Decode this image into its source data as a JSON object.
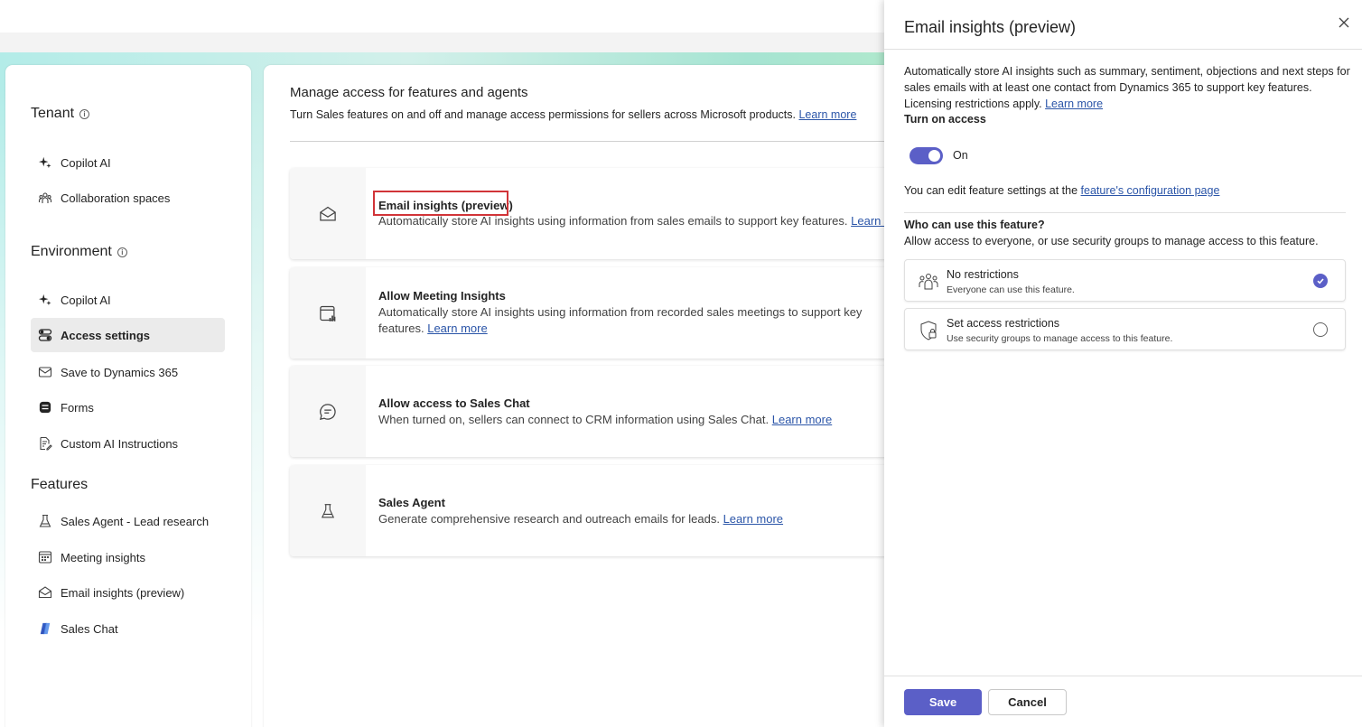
{
  "leftnav": {
    "tenant": {
      "title": "Tenant",
      "items": [
        {
          "label": "Copilot AI",
          "icon": "sparkle-icon"
        },
        {
          "label": "Collaboration spaces",
          "icon": "people-group-icon"
        }
      ]
    },
    "environment": {
      "title": "Environment",
      "items": [
        {
          "label": "Copilot AI",
          "icon": "sparkle-icon"
        },
        {
          "label": "Access settings",
          "icon": "toggle-settings-icon",
          "active": true
        },
        {
          "label": "Save to Dynamics 365",
          "icon": "mail-icon"
        },
        {
          "label": "Forms",
          "icon": "forms-icon"
        },
        {
          "label": "Custom AI Instructions",
          "icon": "document-edit-icon"
        }
      ]
    },
    "features": {
      "title": "Features",
      "items": [
        {
          "label": "Sales Agent - Lead research",
          "icon": "beaker-icon"
        },
        {
          "label": "Meeting insights",
          "icon": "calendar-icon"
        },
        {
          "label": "Email insights (preview)",
          "icon": "mail-open-icon"
        },
        {
          "label": "Sales Chat",
          "icon": "copilot-logo-icon"
        }
      ]
    }
  },
  "main": {
    "title": "Manage access for features and agents",
    "subtitle": "Turn Sales features on and off and manage access permissions for sellers across Microsoft products.",
    "subtitle_link": "Learn more",
    "cards": [
      {
        "title": "Email insights (preview)",
        "desc": "Automatically store AI insights using information from sales emails to support key features.",
        "link": "Learn more",
        "icon": "mail-open-icon"
      },
      {
        "title": "Allow Meeting Insights",
        "desc": "Automatically store AI insights using information from recorded sales meetings to support key features.",
        "link": "Learn more",
        "icon": "calendar-chart-icon"
      },
      {
        "title": "Allow access to Sales Chat",
        "desc": "When turned on, sellers can connect to CRM information using Sales Chat.",
        "link": "Learn more",
        "icon": "chat-icon"
      },
      {
        "title": "Sales Agent",
        "desc": "Generate comprehensive research and outreach emails for leads.",
        "link": "Learn more",
        "icon": "beaker-icon"
      }
    ]
  },
  "panel": {
    "title": "Email insights (preview)",
    "description": "Automatically store AI insights such as summary, sentiment, objections and next steps for sales emails with at least one contact from Dynamics 365 to support key features. Licensing restrictions apply.",
    "description_link": "Learn more",
    "turn_on_label": "Turn on access",
    "toggle_state": "On",
    "edit_text": "You can edit feature settings at the",
    "edit_link": "feature's configuration page",
    "who_title": "Who can use this feature?",
    "who_desc": "Allow access to everyone, or use security groups to manage access to this feature.",
    "options": [
      {
        "title": "No restrictions",
        "desc": "Everyone can use this feature.",
        "selected": true
      },
      {
        "title": "Set access restrictions",
        "desc": "Use security groups to manage access to this feature.",
        "selected": false
      }
    ],
    "save_label": "Save",
    "cancel_label": "Cancel"
  },
  "colors": {
    "accent": "#5b5fc7",
    "highlight": "#d13438",
    "link": "#2b55a8"
  }
}
